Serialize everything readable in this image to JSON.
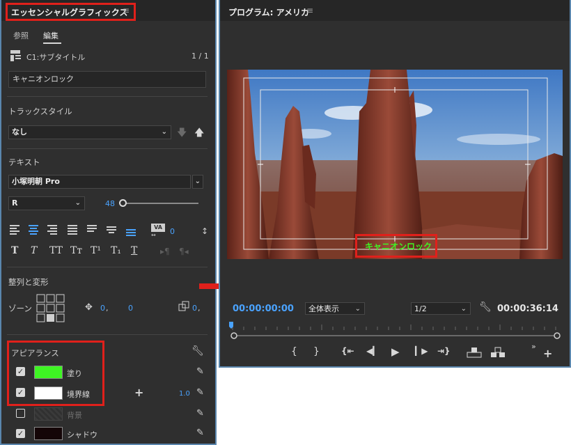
{
  "left_panel": {
    "title": "エッセンシャルグラフィックス",
    "tabs": [
      "参照",
      "編集"
    ],
    "clip_label": "C1:サブタイトル",
    "clip_count": "1 / 1",
    "layer_name": "キャニオンロック",
    "track_style": {
      "heading": "トラックスタイル",
      "value": "なし"
    },
    "text_section": {
      "heading": "テキスト",
      "font": "小塚明朝 Pro",
      "style": "R",
      "size": "48",
      "size_fraction": 0.0,
      "tracking": "0",
      "faux_buttons": [
        "T",
        "T",
        "TT",
        "Tт",
        "T¹",
        "T₁",
        "T"
      ]
    },
    "align_section": {
      "heading": "整列と変形",
      "zone_label": "ゾーン",
      "pos_x": "0",
      "pos_y": "0",
      "anchor_x": "0"
    },
    "appearance": {
      "heading": "アピアランス",
      "items": [
        {
          "label": "塗り",
          "color": "#3ef523",
          "checked": true
        },
        {
          "label": "境界線",
          "color": "#ffffff",
          "checked": true,
          "value": "1.0"
        },
        {
          "label": "背景",
          "color": "#3a3a3a",
          "checked": false
        },
        {
          "label": "シャドウ",
          "color": "#140507",
          "checked": true
        }
      ]
    }
  },
  "program_monitor": {
    "title": "プログラム: アメリカ",
    "caption": "キャニオンロック",
    "caption_color": "#3ef523",
    "timecode_in": "00:00:00:00",
    "fit": "全体表示",
    "resolution": "1/2",
    "timecode_out": "00:00:36:14"
  },
  "colors": {
    "accent_red": "#e0201b",
    "panel_border": "#5a86ad",
    "timecode_blue": "#4aa3ff"
  }
}
